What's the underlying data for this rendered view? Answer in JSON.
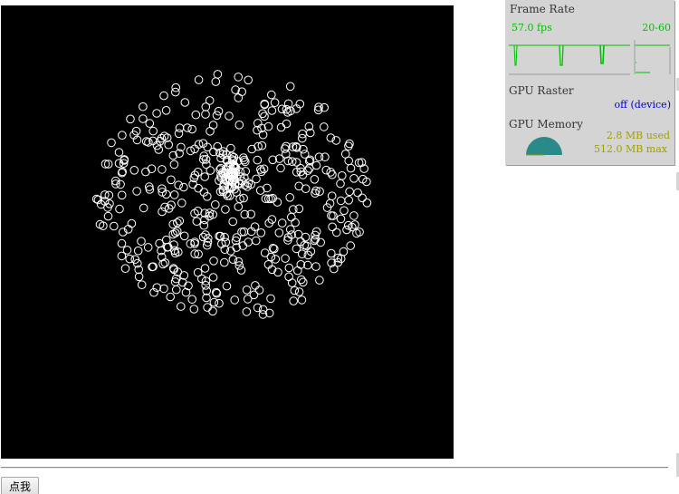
{
  "page": {
    "button_label": "点我"
  },
  "hud": {
    "frame_rate": {
      "title": "Frame Rate",
      "current": "57.0 fps",
      "range": "20-60",
      "value_color": "#00c000"
    },
    "gpu_raster": {
      "title": "GPU Raster",
      "status": "off (device)",
      "status_color": "#0000cc"
    },
    "gpu_memory": {
      "title": "GPU Memory",
      "used": "2.8 MB used",
      "max": "512.0 MB max",
      "used_fraction": 0.0055,
      "value_color": "#a0a000",
      "gauge_color": "#2a8a8a"
    }
  },
  "canvas": {
    "background": "#000000",
    "circle_color": "#ffffff"
  }
}
